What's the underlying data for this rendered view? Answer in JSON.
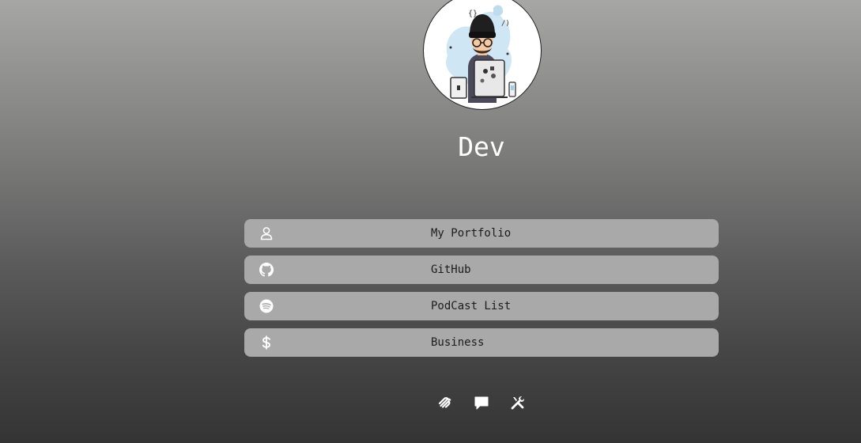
{
  "profile": {
    "name": "Dev",
    "avatar_icon": "developer-avatar-illustration"
  },
  "links": [
    {
      "label": "My Portfolio",
      "icon": "user-icon"
    },
    {
      "label": "GitHub",
      "icon": "github-icon"
    },
    {
      "label": "PodCast List",
      "icon": "spotify-icon"
    },
    {
      "label": "Business",
      "icon": "dollar-icon"
    }
  ],
  "social": [
    {
      "icon": "squarespace-icon"
    },
    {
      "icon": "chat-bubble-icon"
    },
    {
      "icon": "tools-icon"
    }
  ],
  "colors": {
    "button_bg": "#a9a9a9",
    "button_text": "#1c1c1c",
    "title_text": "#ffffff",
    "gradient_top": "#a6a7a4",
    "gradient_bottom": "#343434"
  }
}
